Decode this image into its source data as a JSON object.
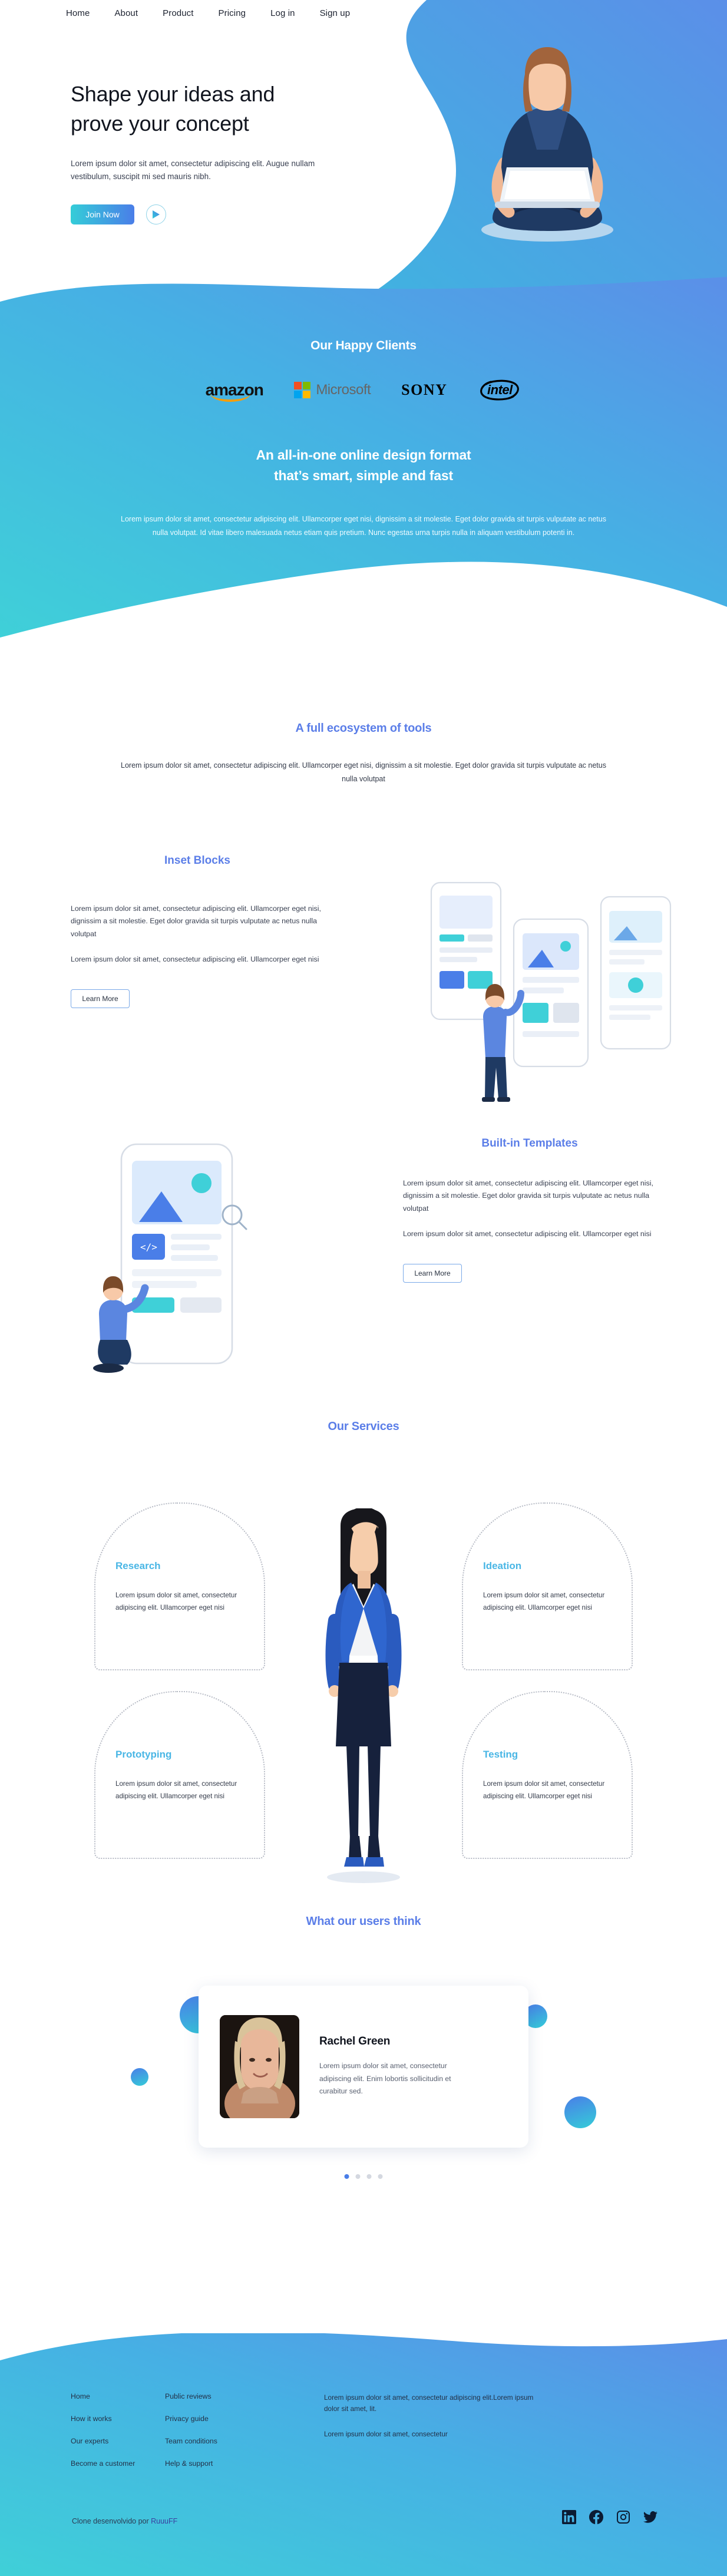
{
  "nav": {
    "items": [
      {
        "label": "Home",
        "name": "nav-home"
      },
      {
        "label": "About",
        "name": "nav-about"
      },
      {
        "label": "Product",
        "name": "nav-product"
      },
      {
        "label": "Pricing",
        "name": "nav-pricing"
      },
      {
        "label": "Log in",
        "name": "nav-login"
      },
      {
        "label": "Sign up",
        "name": "nav-signup"
      }
    ]
  },
  "hero": {
    "title_line1": "Shape your ideas and",
    "title_line2": "prove your concept",
    "subtitle": "Lorem ipsum dolor sit amet, consectetur adipiscing elit. Augue nullam vestibulum, suscipit mi sed mauris nibh.",
    "cta_label": "Join Now",
    "play_icon": "play-icon"
  },
  "clients": {
    "title": "Our Happy Clients",
    "logos": [
      "amazon",
      "Microsoft",
      "SONY",
      "intel"
    ]
  },
  "band": {
    "heading_line1": "An all-in-one online design format",
    "heading_line2": "that’s smart, simple and fast",
    "paragraph": "Lorem ipsum dolor sit amet, consectetur adipiscing elit. Ullamcorper eget nisi, dignissim a sit molestie. Eget dolor gravida sit turpis vulputate ac netus nulla volutpat. Id vitae libero malesuada netus etiam quis pretium. Nunc egestas urna turpis nulla in aliquam vestibulum potenti in."
  },
  "ecosystem": {
    "title": "A full ecosystem of tools",
    "paragraph": "Lorem ipsum dolor sit amet, consectetur adipiscing elit. Ullamcorper eget nisi, dignissim a sit molestie. Eget dolor gravida sit turpis vulputate ac netus nulla volutpat"
  },
  "inset": {
    "title": "Inset Blocks",
    "paragraph1": "Lorem ipsum dolor sit amet, consectetur adipiscing elit. Ullamcorper eget nisi, dignissim a sit molestie. Eget dolor gravida sit turpis vulputate ac netus nulla volutpat",
    "paragraph2": "Lorem ipsum dolor sit amet, consectetur adipiscing elit. Ullamcorper eget nisi",
    "button_label": "Learn More"
  },
  "templates": {
    "title": "Built-in Templates",
    "paragraph1": "Lorem ipsum dolor sit amet, consectetur adipiscing elit. Ullamcorper eget nisi, dignissim a sit molestie. Eget dolor gravida sit turpis vulputate ac netus nulla volutpat",
    "paragraph2": "Lorem ipsum dolor sit amet, consectetur adipiscing elit. Ullamcorper eget nisi",
    "button_label": "Learn More"
  },
  "services": {
    "title": "Our Services",
    "cards": [
      {
        "title": "Research",
        "body": "Lorem ipsum dolor sit amet, consectetur adipiscing elit. Ullamcorper eget nisi"
      },
      {
        "title": "Ideation",
        "body": "Lorem ipsum dolor sit amet, consectetur adipiscing elit. Ullamcorper eget nisi"
      },
      {
        "title": "Prototyping",
        "body": "Lorem ipsum dolor sit amet, consectetur adipiscing elit. Ullamcorper eget nisi"
      },
      {
        "title": "Testing",
        "body": "Lorem ipsum dolor sit amet, consectetur adipiscing elit. Ullamcorper eget nisi"
      }
    ]
  },
  "testimonials": {
    "title": "What our users think",
    "name": "Rachel Green",
    "quote": "Lorem ipsum dolor sit amet, consectetur adipiscing elit. Enim lobortis sollicitudin et curabitur sed.",
    "dots_count": 4,
    "active_dot": 0
  },
  "footer": {
    "col1": [
      "Home",
      "How it works",
      "Our experts",
      "Become a customer"
    ],
    "col2": [
      "Public reviews",
      "Privacy guide",
      "Team conditions",
      "Help & support"
    ],
    "col3": [
      "Lorem ipsum dolor sit amet, consectetur adipiscing elit.Lorem ipsum dolor sit amet, lit.",
      "Lorem ipsum dolor sit amet, consectetur"
    ],
    "credit_prefix": "Clone desenvolvido por ",
    "credit_author": "RuuuFF",
    "socials": [
      "linkedin-icon",
      "facebook-icon",
      "instagram-icon",
      "twitter-icon"
    ]
  },
  "colors": {
    "accent_blue": "#5b7ee8",
    "cyan": "#34cdd8",
    "light_blue": "#49b6e5",
    "dark_text": "#11151f"
  }
}
